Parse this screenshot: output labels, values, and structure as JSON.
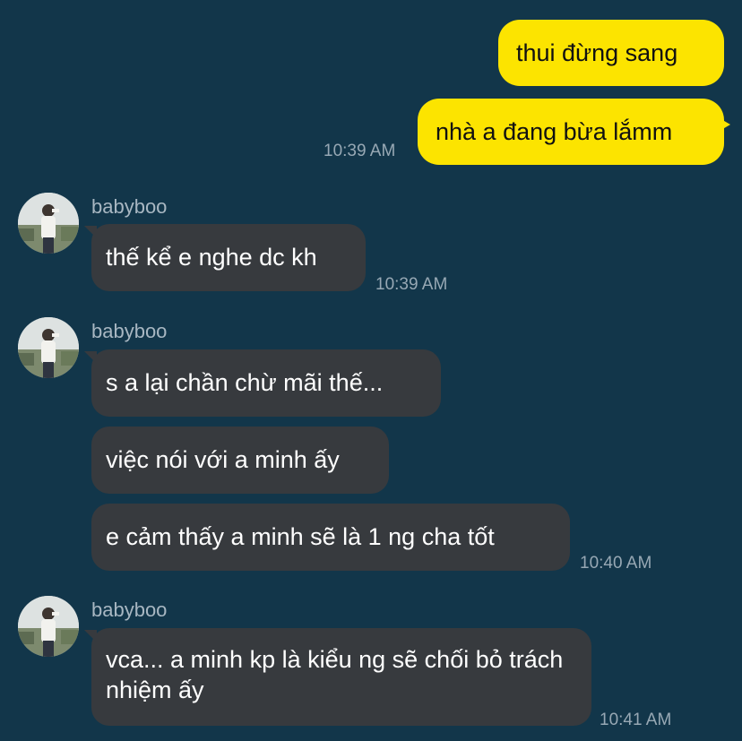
{
  "conversation": {
    "contact_name": "babyboo",
    "outgoing": [
      {
        "text": "thui đừng sang"
      },
      {
        "text": "nhà a đang bừa lắmm",
        "time": "10:39 AM"
      }
    ],
    "groups": [
      {
        "sender": "babyboo",
        "messages": [
          {
            "text": "thế kể e nghe dc kh"
          }
        ],
        "time": "10:39 AM"
      },
      {
        "sender": "babyboo",
        "messages": [
          {
            "text": "s a lại chần chừ mãi thế..."
          },
          {
            "text": "việc nói với a minh ấy"
          },
          {
            "text": "e cảm thấy a minh sẽ là 1 ng cha tốt"
          }
        ],
        "time": "10:40 AM"
      },
      {
        "sender": "babyboo",
        "messages": [
          {
            "text": "vca... a minh kp là kiểu ng sẽ chối bỏ trách nhiệm ấy"
          }
        ],
        "time": "10:41 AM"
      }
    ]
  },
  "colors": {
    "background": "#12364a",
    "outgoing_bubble": "#fce400",
    "incoming_bubble": "#373a3e",
    "timestamp": "#97a8b4",
    "sender_name": "#a8b7c2"
  }
}
